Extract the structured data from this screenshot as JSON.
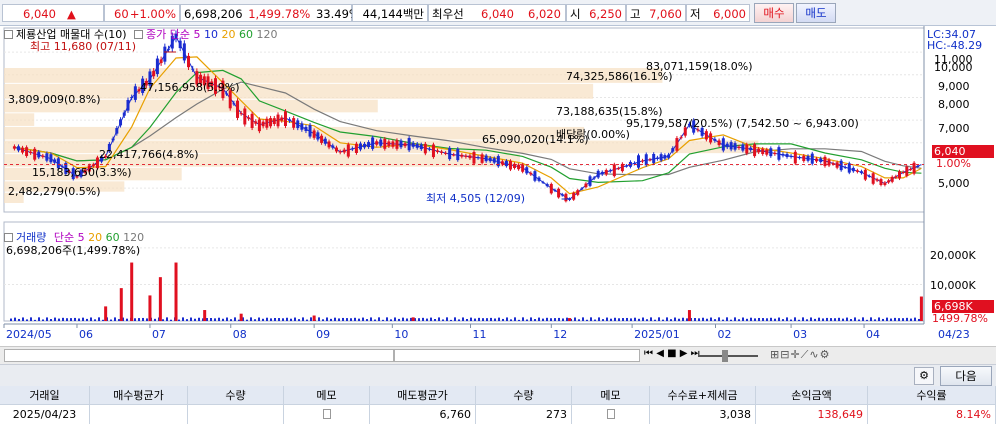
{
  "ticker": {
    "price": "6,040",
    "arrow": "▲",
    "change": "60",
    "change_pct": "+1.00%",
    "volume": "6,698,206",
    "volume_ratio": "1,499.78%",
    "rotation": "33.49%",
    "amount": "44,144백만",
    "best_ask_label": "최우선",
    "best_ask": "6,040",
    "best_bid": "6,020",
    "open_label": "시",
    "open": "6,250",
    "high_label": "고",
    "high": "7,060",
    "low_label": "저",
    "low": "6,000",
    "buy_label": "매수",
    "sell_label": "매도"
  },
  "chart": {
    "price_title": "제룡산업 매물대 수(10)",
    "ma_label": "종가 단순",
    "ma_periods": [
      "5",
      "10",
      "20",
      "60",
      "120"
    ],
    "ma_colors": [
      "#b000c0",
      "#1a2cd0",
      "#e8a000",
      "#22a030",
      "#7a7a7a"
    ],
    "high_marker": "최고 11,680 (07/11)",
    "low_marker": "최저 4,505 (12/09)",
    "dividend_label": "배당락(0.00%)",
    "range_label": "(7,542.50 ~ 6,943.00)",
    "lc_label": "LC:34.07",
    "hc_label": "HC:-48.29",
    "profile": [
      {
        "text": "83,071,159(18.0%)"
      },
      {
        "text": "74,325,586(16.1%)"
      },
      {
        "text": "47,156,958(5.9%)"
      },
      {
        "text": "3,809,009(0.8%)"
      },
      {
        "text": "73,188,635(15.8%)"
      },
      {
        "text": "95,179,587(20.5%)"
      },
      {
        "text": "65,090,020(14.1%)"
      },
      {
        "text": "22,417,766(4.8%)"
      },
      {
        "text": "15,183,650(3.3%)"
      },
      {
        "text": "2,482,279(0.5%)"
      }
    ],
    "y_ticks": [
      "11,000",
      "10,000",
      "9,000",
      "8,000",
      "7,000",
      "5,000"
    ],
    "current_price_tag": "6,040",
    "current_pct_tag": "1.00%",
    "volume_title": "거래량",
    "volume_ma_label": "단순",
    "volume_ma_periods": [
      "5",
      "20",
      "60",
      "120"
    ],
    "volume_ma_colors": [
      "#b000c0",
      "#e8a000",
      "#22a030",
      "#7a7a7a"
    ],
    "volume_value": "6,698,206주(1,499.78%)",
    "volume_ticks": [
      "20,000K",
      "10,000K"
    ],
    "volume_tag": "6,698K",
    "volume_pct_tag": "1499.78%",
    "x_ticks": [
      "2024/05",
      "06",
      "07",
      "08",
      "09",
      "10",
      "11",
      "12",
      "2025/01",
      "02",
      "03",
      "04",
      "04/23"
    ]
  },
  "toolbar": {
    "next_label": "다음"
  },
  "table": {
    "headers": [
      "거래일",
      "매수평균가",
      "수량",
      "메모",
      "매도평균가",
      "수량",
      "메모",
      "수수료+제세금",
      "손익금액",
      "수익률"
    ],
    "row": {
      "date": "2025/04/23",
      "buy_avg": "",
      "buy_qty": "",
      "sell_avg": "6,760",
      "sell_qty": "273",
      "fee": "3,038",
      "pnl": "138,649",
      "return": "8.14%"
    }
  },
  "chart_data": {
    "type": "candlestick",
    "title": "제룡산업 매물대 수(10)",
    "x_ticks": [
      "2024/05",
      "06",
      "07",
      "08",
      "09",
      "10",
      "11",
      "12",
      "2025/01",
      "02",
      "03",
      "04",
      "04/23"
    ],
    "ylim": [
      4300,
      11800
    ],
    "close_series": [
      [
        "2024/05/10",
        6800
      ],
      [
        "2024/05/24",
        6300
      ],
      [
        "2024/06/03",
        5500
      ],
      [
        "2024/06/14",
        6400
      ],
      [
        "2024/06/24",
        9000
      ],
      [
        "2024/07/01",
        9800
      ],
      [
        "2024/07/11",
        11680
      ],
      [
        "2024/07/19",
        9900
      ],
      [
        "2024/07/29",
        9400
      ],
      [
        "2024/08/05",
        8300
      ],
      [
        "2024/08/12",
        7800
      ],
      [
        "2024/08/22",
        8100
      ],
      [
        "2024/09/02",
        7400
      ],
      [
        "2024/09/12",
        6600
      ],
      [
        "2024/09/26",
        7000
      ],
      [
        "2024/10/10",
        6900
      ],
      [
        "2024/10/24",
        6500
      ],
      [
        "2024/11/07",
        6300
      ],
      [
        "2024/11/21",
        5900
      ],
      [
        "2024/12/02",
        5000
      ],
      [
        "2024/12/09",
        4505
      ],
      [
        "2024/12/20",
        5600
      ],
      [
        "2025/01/06",
        6200
      ],
      [
        "2025/01/16",
        6400
      ],
      [
        "2025/01/24",
        7800
      ],
      [
        "2025/02/06",
        6900
      ],
      [
        "2025/02/18",
        6700
      ],
      [
        "2025/03/04",
        6400
      ],
      [
        "2025/03/17",
        6200
      ],
      [
        "2025/03/31",
        5700
      ],
      [
        "2025/04/09",
        5200
      ],
      [
        "2025/04/16",
        5700
      ],
      [
        "2025/04/23",
        6040
      ]
    ],
    "volume_profile": [
      {
        "price_from": 9600,
        "price_to": 10300,
        "volume": 83071159,
        "pct": 18.0
      },
      {
        "price_from": 8900,
        "price_to": 9600,
        "volume": 74325586,
        "pct": 16.1
      },
      {
        "price_from": 8300,
        "price_to": 8900,
        "volume": 47156958,
        "pct": 5.9
      },
      {
        "price_from": 7700,
        "price_to": 8300,
        "volume": 3809009,
        "pct": 0.8
      },
      {
        "price_from": 7100,
        "price_to": 7700,
        "volume": 73188635,
        "pct": 15.8
      },
      {
        "price_from": 6500,
        "price_to": 7100,
        "volume": 95179587,
        "pct": 20.5
      },
      {
        "price_from": 5900,
        "price_to": 6500,
        "volume": 65090020,
        "pct": 14.1
      },
      {
        "price_from": 5300,
        "price_to": 5900,
        "volume": 22417766,
        "pct": 4.8
      },
      {
        "price_from": 4800,
        "price_to": 5300,
        "volume": 15183650,
        "pct": 3.3
      },
      {
        "price_from": 4300,
        "price_to": 4800,
        "volume": 2482279,
        "pct": 0.5
      }
    ],
    "volume_series_k": [
      [
        "2024/06/14",
        4000
      ],
      [
        "2024/06/20",
        9000
      ],
      [
        "2024/06/24",
        16000
      ],
      [
        "2024/07/01",
        7000
      ],
      [
        "2024/07/05",
        12000
      ],
      [
        "2024/07/11",
        16000
      ],
      [
        "2024/07/22",
        3000
      ],
      [
        "2024/08/05",
        2000
      ],
      [
        "2024/09/02",
        1500
      ],
      [
        "2024/10/10",
        1000
      ],
      [
        "2024/12/09",
        800
      ],
      [
        "2025/01/24",
        3000
      ],
      [
        "2025/04/23",
        6698
      ]
    ]
  }
}
